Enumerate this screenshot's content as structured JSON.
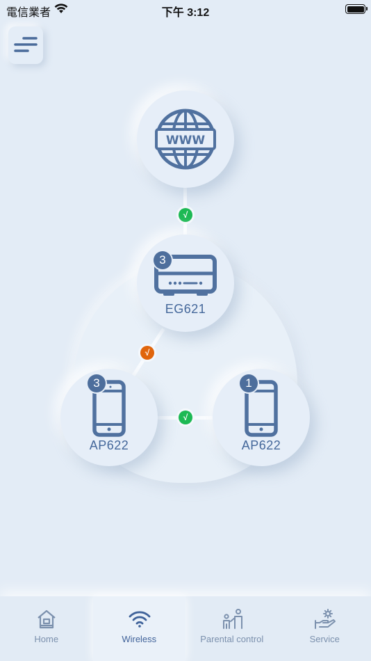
{
  "status_bar": {
    "carrier": "電信業者",
    "time": "下午 3:12"
  },
  "menu": {
    "icon": "sort-icon"
  },
  "topology": {
    "internet": {
      "icon": "globe-www-icon",
      "text": "WWW"
    },
    "gateway": {
      "name": "EG621",
      "badge": "3",
      "icon": "router-icon"
    },
    "ap_left": {
      "name": "AP622",
      "badge": "3",
      "icon": "phone-icon"
    },
    "ap_right": {
      "name": "AP622",
      "badge": "1",
      "icon": "phone-icon"
    },
    "link_internet_gateway": {
      "status": "good",
      "color": "#1db954",
      "mark": "√"
    },
    "link_gateway_ap_left": {
      "status": "warning",
      "color": "#e0650c",
      "mark": "√"
    },
    "link_ap_left_ap_right": {
      "status": "good",
      "color": "#1db954",
      "mark": "√"
    }
  },
  "tabs": [
    {
      "label": "Home",
      "icon": "home-icon",
      "active": false
    },
    {
      "label": "Wireless",
      "icon": "wifi-icon",
      "active": true
    },
    {
      "label": "Parental control",
      "icon": "parent-child-icon",
      "active": false
    },
    {
      "label": "Service",
      "icon": "service-hand-gear-icon",
      "active": false
    }
  ]
}
